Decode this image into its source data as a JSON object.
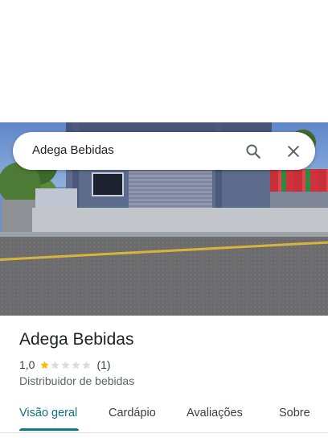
{
  "search": {
    "query": "Adega Bebidas"
  },
  "place": {
    "name": "Adega Bebidas",
    "rating_text": "1,0",
    "rating_value": 1.0,
    "stars_max": 5,
    "review_count_text": "(1)",
    "category": "Distribuidor de bebidas"
  },
  "tabs": [
    {
      "label": "Visão geral",
      "active": true
    },
    {
      "label": "Cardápio",
      "active": false
    },
    {
      "label": "Avaliações",
      "active": false
    },
    {
      "label": "Sobre",
      "active": false
    }
  ],
  "icons": {
    "search": "search-icon",
    "close": "close-icon",
    "star": "star-icon"
  },
  "colors": {
    "accent": "#0b7a8a",
    "star_filled": "#fbbc04",
    "star_empty": "#dadce0"
  }
}
